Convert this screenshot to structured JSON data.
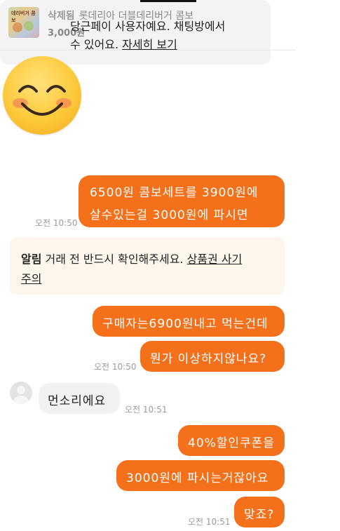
{
  "product": {
    "status": "삭제됨",
    "title": "롯데리아 더블데리버거 콤보",
    "price": "3,000원",
    "thumb_text": "데리버거 콤보"
  },
  "system_notice": {
    "line1": "당근페이 사용자예요. 채팅방에서",
    "line2_prefix": "수 있어요. ",
    "line2_link": "자세히 보기"
  },
  "messages": [
    {
      "side": "me",
      "lines": [
        "6500원 콤보세트를 3900원에",
        "살수있는걸 3000원에 파시면"
      ],
      "time": "오전 10:50"
    },
    {
      "side": "me",
      "lines": [
        "구매자는6900원내고 먹는건데"
      ]
    },
    {
      "side": "me",
      "lines": [
        "뭔가 이상하지않나요?"
      ],
      "time": "오전 10:50"
    },
    {
      "side": "them",
      "lines": [
        "먼소리에요"
      ],
      "time": "오전 10:51"
    },
    {
      "side": "me",
      "lines": [
        "40%할인쿠폰을"
      ]
    },
    {
      "side": "me",
      "lines": [
        "3000원에 파시는거잖아요"
      ]
    },
    {
      "side": "me",
      "lines": [
        "맞죠?"
      ],
      "time": "오전 10:51"
    }
  ],
  "alert": {
    "label": "알림",
    "text": " 거래 전 반드시 확인해주세요. ",
    "link": "상품권 사기",
    "link2": "주의"
  },
  "colors": {
    "accent": "#f5701b",
    "gray_bubble": "#f1f2f4",
    "alert_bg": "#fdf6ec"
  },
  "icons": [
    "smiling-emoji-icon",
    "default-avatar-icon"
  ]
}
